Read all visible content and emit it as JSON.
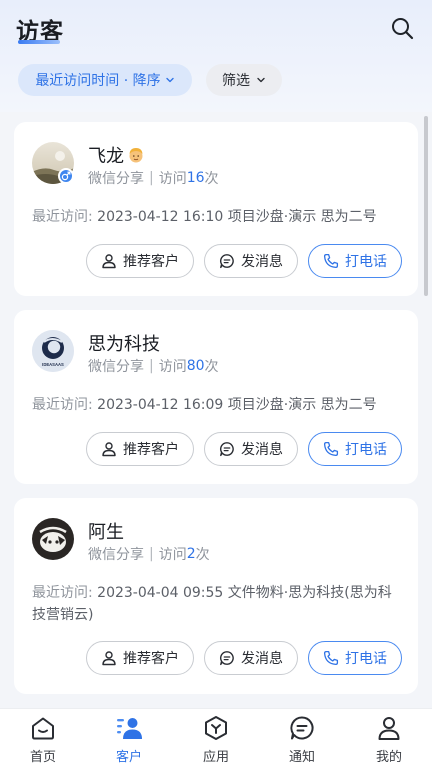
{
  "header": {
    "title": "访客",
    "search_icon": "search-icon"
  },
  "filters": {
    "sort_label": "最近访问时间 · 降序",
    "filter_label": "筛选"
  },
  "colors": {
    "accent": "#2f73e6",
    "page_bg": "#f3f5f9",
    "card_bg": "#ffffff"
  },
  "visitors": [
    {
      "name": "飞龙",
      "name_emoji_icon": "person-emoji-icon",
      "gender_icon": "male-icon",
      "source": "微信分享",
      "visit_prefix": "访问",
      "visit_count": "16",
      "visit_suffix": "次",
      "last_visit_label": "最近访问:",
      "last_visit_text": "2023-04-12 16:10 项目沙盘·演示 思为二号",
      "recommend_label": "推荐客户",
      "message_label": "发消息",
      "call_label": "打电话"
    },
    {
      "name": "思为科技",
      "avatar_logo_text": "IDEASAAS",
      "source": "微信分享",
      "visit_prefix": "访问",
      "visit_count": "80",
      "visit_suffix": "次",
      "last_visit_label": "最近访问:",
      "last_visit_text": "2023-04-12 16:09 项目沙盘·演示 思为二号",
      "recommend_label": "推荐客户",
      "message_label": "发消息",
      "call_label": "打电话"
    },
    {
      "name": "阿生",
      "source": "微信分享",
      "visit_prefix": "访问",
      "visit_count": "2",
      "visit_suffix": "次",
      "last_visit_label": "最近访问:",
      "last_visit_text": "2023-04-04 09:55 文件物料·思为科技(思为科技营销云)",
      "recommend_label": "推荐客户",
      "message_label": "发消息",
      "call_label": "打电话"
    }
  ],
  "tabbar": {
    "items": [
      {
        "label": "首页",
        "icon": "home-icon"
      },
      {
        "label": "客户",
        "icon": "customers-icon",
        "active": true
      },
      {
        "label": "应用",
        "icon": "apps-icon"
      },
      {
        "label": "通知",
        "icon": "notification-icon"
      },
      {
        "label": "我的",
        "icon": "profile-icon"
      }
    ]
  }
}
